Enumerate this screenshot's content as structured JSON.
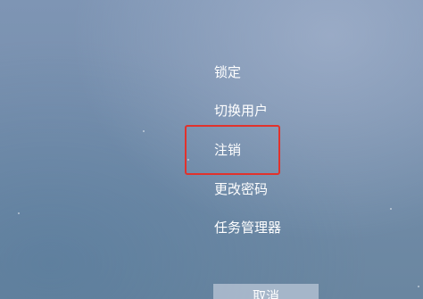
{
  "menu": {
    "items": [
      {
        "label": "锁定"
      },
      {
        "label": "切换用户"
      },
      {
        "label": "注销",
        "highlighted": true
      },
      {
        "label": "更改密码"
      },
      {
        "label": "任务管理器"
      }
    ]
  },
  "cancel": {
    "label": "取消"
  },
  "colors": {
    "background": "#7890ae",
    "text": "#ffffff",
    "highlight_border": "#e1322c",
    "cancel_button": "#b0bed0"
  }
}
